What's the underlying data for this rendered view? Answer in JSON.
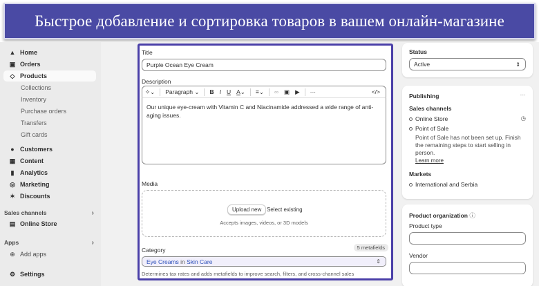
{
  "banner": {
    "text": "Быстрое добавление и сортировка товаров в вашем онлайн-магазине"
  },
  "sidebar": {
    "home": "Home",
    "orders": "Orders",
    "products": "Products",
    "product_sub": [
      "Collections",
      "Inventory",
      "Purchase orders",
      "Transfers",
      "Gift cards"
    ],
    "customers": "Customers",
    "content": "Content",
    "analytics": "Analytics",
    "marketing": "Marketing",
    "discounts": "Discounts",
    "sales_channels_label": "Sales channels",
    "online_store": "Online Store",
    "apps_label": "Apps",
    "add_apps": "Add apps",
    "settings": "Settings"
  },
  "main": {
    "title_label": "Title",
    "title_value": "Purple Ocean Eye Cream",
    "description_label": "Description",
    "toolbar": {
      "paragraph": "Paragraph",
      "more": "···",
      "code": "</>"
    },
    "description_text": "Our unique eye-cream with Vitamin C and Niacinamide addressed a wide range of anti-aging issues.",
    "media_label": "Media",
    "upload_new": "Upload new",
    "select_existing": "Select existing",
    "media_hint": "Accepts images, videos, or 3D models",
    "category_label": "Category",
    "metafields_badge": "5 metafields",
    "category_value": "Eye Creams",
    "category_in": "in",
    "category_parent": "Skin Care",
    "category_hint": "Determines tax rates and adds metafields to improve search, filters, and cross-channel sales"
  },
  "status_card": {
    "label": "Status",
    "value": "Active"
  },
  "publishing": {
    "title": "Publishing",
    "more": "···",
    "sales_channels": "Sales channels",
    "online_store": "Online Store",
    "point_of_sale": "Point of Sale",
    "pos_note": "Point of Sale has not been set up. Finish the remaining steps to start selling in person.",
    "learn_more": "Learn more",
    "markets": "Markets",
    "markets_value": "International and Serbia"
  },
  "organization": {
    "title": "Product organization",
    "product_type": "Product type",
    "vendor": "Vendor"
  },
  "colors": {
    "banner": "#4a4aa4",
    "highlight": "#4a3fa8",
    "link": "#2c4fb8"
  }
}
